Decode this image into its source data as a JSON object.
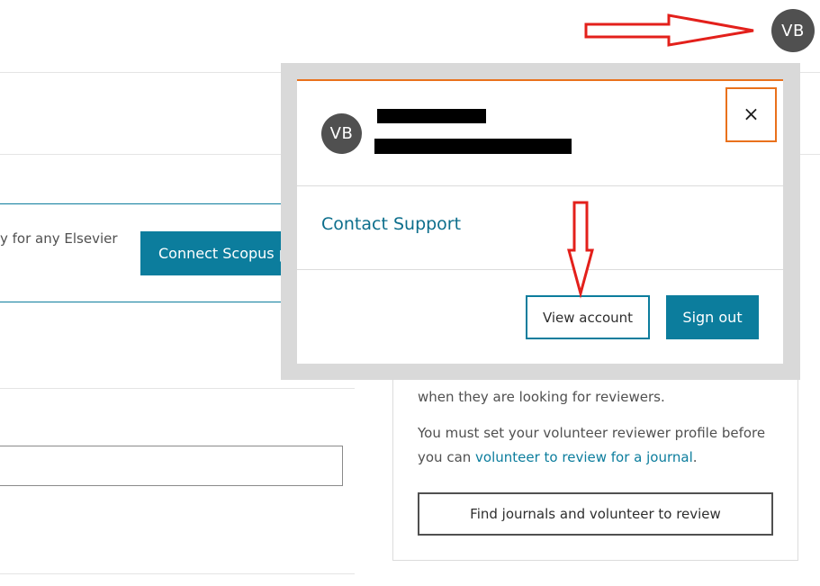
{
  "header": {
    "avatar_initials": "VB"
  },
  "background": {
    "partial_text": "y for any Elsevier",
    "connect_button": "Connect Scopus pr",
    "card_line1": "when they are looking for reviewers.",
    "card_line2": "You must set your volunteer reviewer profile before",
    "card_line3_prefix": "you can ",
    "card_line3_link": "volunteer to review for a journal",
    "card_line3_suffix": ".",
    "find_button": "Find journals and volunteer to review"
  },
  "popup": {
    "avatar_initials": "VB",
    "close_label": "×",
    "contact_support": "Contact Support",
    "view_account": "View account",
    "sign_out": "Sign out"
  },
  "colors": {
    "primary_teal": "#0c7d9d",
    "focus_orange": "#e9711c",
    "annotation_red": "#e3201b"
  }
}
